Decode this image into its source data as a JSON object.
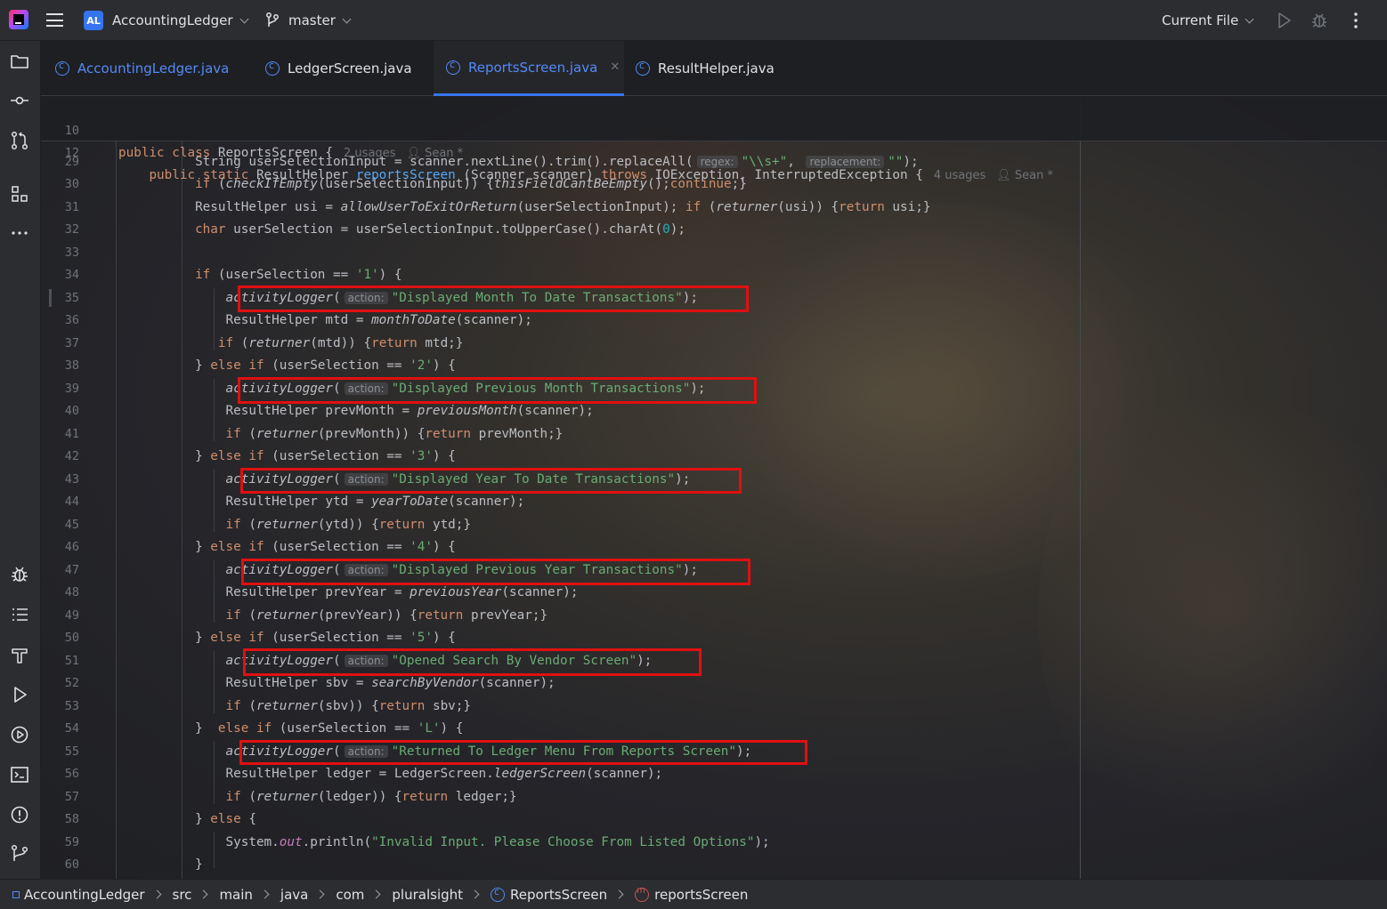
{
  "titlebar": {
    "project_badge": "AL",
    "project_name": "AccountingLedger",
    "branch": "master",
    "run_config": "Current File",
    "icons": [
      "app-logo-icon",
      "main-menu-icon",
      "branch-icon",
      "run-icon",
      "debug-icon",
      "more-icon"
    ]
  },
  "toolstrip": {
    "top_icons": [
      "project-folder-icon",
      "commit-icon",
      "pull-requests-icon",
      "structure-icon",
      "more-tools-icon"
    ],
    "bottom_icons": [
      "debug-icon",
      "todo-icon",
      "build-icon",
      "run-icon",
      "services-icon",
      "terminal-icon",
      "problems-icon",
      "git-icon"
    ]
  },
  "tabs": [
    {
      "label": "AccountingLedger.java",
      "active": false
    },
    {
      "label": "LedgerScreen.java",
      "active": false
    },
    {
      "label": "ReportsScreen.java",
      "active": true
    },
    {
      "label": "ResultHelper.java",
      "active": false
    }
  ],
  "sticky": {
    "line1_num": "10",
    "line1_code": "public class ReportsScreen {",
    "line1_usages": "2 usages",
    "line1_author": "Sean *",
    "line2_num": "12",
    "line2_code": "public static ResultHelper reportsScreen (Scanner scanner) throws IOException, InterruptedException {",
    "line2_usages": "4 usages",
    "line2_author": "Sean *"
  },
  "code_lines": [
    {
      "n": "29"
    },
    {
      "n": "30"
    },
    {
      "n": "31"
    },
    {
      "n": "32"
    },
    {
      "n": "33"
    },
    {
      "n": "34"
    },
    {
      "n": "35"
    },
    {
      "n": "36"
    },
    {
      "n": "37"
    },
    {
      "n": "38"
    },
    {
      "n": "39"
    },
    {
      "n": "40"
    },
    {
      "n": "41"
    },
    {
      "n": "42"
    },
    {
      "n": "43"
    },
    {
      "n": "44"
    },
    {
      "n": "45"
    },
    {
      "n": "46"
    },
    {
      "n": "47"
    },
    {
      "n": "48"
    },
    {
      "n": "49"
    },
    {
      "n": "50"
    },
    {
      "n": "51"
    },
    {
      "n": "52"
    },
    {
      "n": "53"
    },
    {
      "n": "54"
    },
    {
      "n": "55"
    },
    {
      "n": "56"
    },
    {
      "n": "57"
    },
    {
      "n": "58"
    },
    {
      "n": "59"
    },
    {
      "n": "60"
    }
  ],
  "code": {
    "l29": {
      "a": "String userSelectionInput = scanner.nextLine().trim().replaceAll(",
      "hint1": "regex:",
      "s1": "\"\\\\s+\"",
      "c1": ",",
      "hint2": "replacement:",
      "s2": "\"\"",
      "end": ");"
    },
    "l30": {
      "kw": "if",
      "a": " (",
      "fn": "checkIfEmpty",
      "b": "(userSelectionInput)) {",
      "fn2": "thisFieldCantBeEmpty",
      "c": "();",
      "kw2": "continue",
      "d": ";}"
    },
    "l31": {
      "a": "ResultHelper usi = ",
      "fn": "allowUserToExitOrReturn",
      "b": "(userSelectionInput); ",
      "kw": "if",
      "c": " (",
      "fn2": "returner",
      "d": "(usi)) {",
      "kw2": "return",
      "e": " usi;}"
    },
    "l32": {
      "kw": "char",
      "a": " userSelection = userSelectionInput.toUpperCase().charAt(",
      "num": "0",
      "b": ");"
    },
    "l34": {
      "kw": "if",
      "a": " (userSelection == ",
      "s": "'1'",
      "b": ") {"
    },
    "l35": {
      "fn": "activityLogger",
      "a": "(",
      "hint": "action:",
      "s": "\"Displayed Month To Date Transactions\"",
      "b": ");"
    },
    "l36": {
      "a": "ResultHelper mtd = ",
      "fn": "monthToDate",
      "b": "(scanner);"
    },
    "l37": {
      "kw": "if",
      "a": " (",
      "fn": "returner",
      "b": "(mtd)) {",
      "kw2": "return",
      "c": " mtd;}"
    },
    "l38": {
      "a": "} ",
      "kw": "else if",
      "b": " (userSelection == ",
      "s": "'2'",
      "c": ") {"
    },
    "l39": {
      "fn": "activityLogger",
      "a": "(",
      "hint": "action:",
      "s": "\"Displayed Previous Month Transactions\"",
      "b": ");"
    },
    "l40": {
      "a": "ResultHelper prevMonth = ",
      "fn": "previousMonth",
      "b": "(scanner);"
    },
    "l41": {
      "kw": "if",
      "a": " (",
      "fn": "returner",
      "b": "(prevMonth)) {",
      "kw2": "return",
      "c": " prevMonth;}"
    },
    "l42": {
      "a": "} ",
      "kw": "else if",
      "b": " (userSelection == ",
      "s": "'3'",
      "c": ") {"
    },
    "l43": {
      "fn": "activityLogger",
      "a": "(",
      "hint": "action:",
      "s": "\"Displayed Year To Date Transactions\"",
      "b": ");"
    },
    "l44": {
      "a": "ResultHelper ytd = ",
      "fn": "yearToDate",
      "b": "(scanner);"
    },
    "l45": {
      "kw": "if",
      "a": " (",
      "fn": "returner",
      "b": "(ytd)) {",
      "kw2": "return",
      "c": " ytd;}"
    },
    "l46": {
      "a": "} ",
      "kw": "else if",
      "b": " (userSelection == ",
      "s": "'4'",
      "c": ") {"
    },
    "l47": {
      "fn": "activityLogger",
      "a": "(",
      "hint": "action:",
      "s": "\"Displayed Previous Year Transactions\"",
      "b": ");"
    },
    "l48": {
      "a": "ResultHelper prevYear = ",
      "fn": "previousYear",
      "b": "(scanner);"
    },
    "l49": {
      "kw": "if",
      "a": " (",
      "fn": "returner",
      "b": "(prevYear)) {",
      "kw2": "return",
      "c": " prevYear;}"
    },
    "l50": {
      "a": "} ",
      "kw": "else if",
      "b": " (userSelection == ",
      "s": "'5'",
      "c": ") {"
    },
    "l51": {
      "fn": "activityLogger",
      "a": "(",
      "hint": "action:",
      "s": "\"Opened Search By Vendor Screen\"",
      "b": ");"
    },
    "l52": {
      "a": "ResultHelper sbv = ",
      "fn": "searchByVendor",
      "b": "(scanner);"
    },
    "l53": {
      "kw": "if",
      "a": " (",
      "fn": "returner",
      "b": "(sbv)) {",
      "kw2": "return",
      "c": " sbv;}"
    },
    "l54": {
      "a": "}  ",
      "kw": "else if",
      "b": " (userSelection == ",
      "s": "'L'",
      "c": ") {"
    },
    "l55": {
      "fn": "activityLogger",
      "a": "(",
      "hint": "action:",
      "s": "\"Returned To Ledger Menu From Reports Screen\"",
      "b": ");"
    },
    "l56": {
      "a": "ResultHelper ledger = LedgerScreen.",
      "fn": "ledgerScreen",
      "b": "(scanner);"
    },
    "l57": {
      "kw": "if",
      "a": " (",
      "fn": "returner",
      "b": "(ledger)) {",
      "kw2": "return",
      "c": " ledger;}"
    },
    "l58": {
      "a": "} ",
      "kw": "else",
      "b": " {"
    },
    "l59": {
      "a": "System.",
      "fld": "out",
      "b": ".println(",
      "s": "\"Invalid Input. Please Choose From Listed Options\"",
      "c": ");"
    },
    "l60": {
      "a": "}"
    }
  },
  "breadcrumb": [
    "AccountingLedger",
    "src",
    "main",
    "java",
    "com",
    "pluralsight",
    "ReportsScreen",
    "reportsScreen"
  ],
  "colors": {
    "keyword": "#cf8e6d",
    "string": "#6aab73",
    "method": "#56a8f5",
    "number": "#2aacb8",
    "highlight_box": "#e01010",
    "accent": "#3574f0"
  }
}
